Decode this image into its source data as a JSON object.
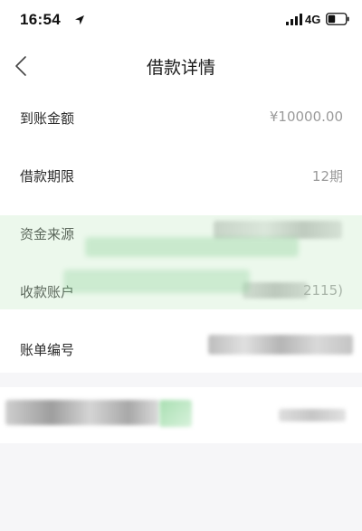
{
  "status_bar": {
    "time": "16:54",
    "network": "4G"
  },
  "header": {
    "title": "借款详情"
  },
  "details": {
    "received_amount": {
      "label": "到账金额",
      "value": "¥10000.00"
    },
    "loan_term": {
      "label": "借款期限",
      "value": "12期"
    },
    "fund_source": {
      "label": "资金来源",
      "value": ""
    },
    "receiving_account": {
      "label": "收款账户",
      "value": "2115)"
    },
    "bill_number": {
      "label": "账单编号",
      "value": ""
    }
  },
  "icons": {
    "back": "chevron-left-icon",
    "location": "location-arrow-icon",
    "signal": "cellular-signal-icon",
    "battery": "battery-icon"
  },
  "colors": {
    "background": "#f6f6f8",
    "card": "#ffffff",
    "value_text": "#9a9a9a",
    "watermark": "#c4e8c4"
  }
}
